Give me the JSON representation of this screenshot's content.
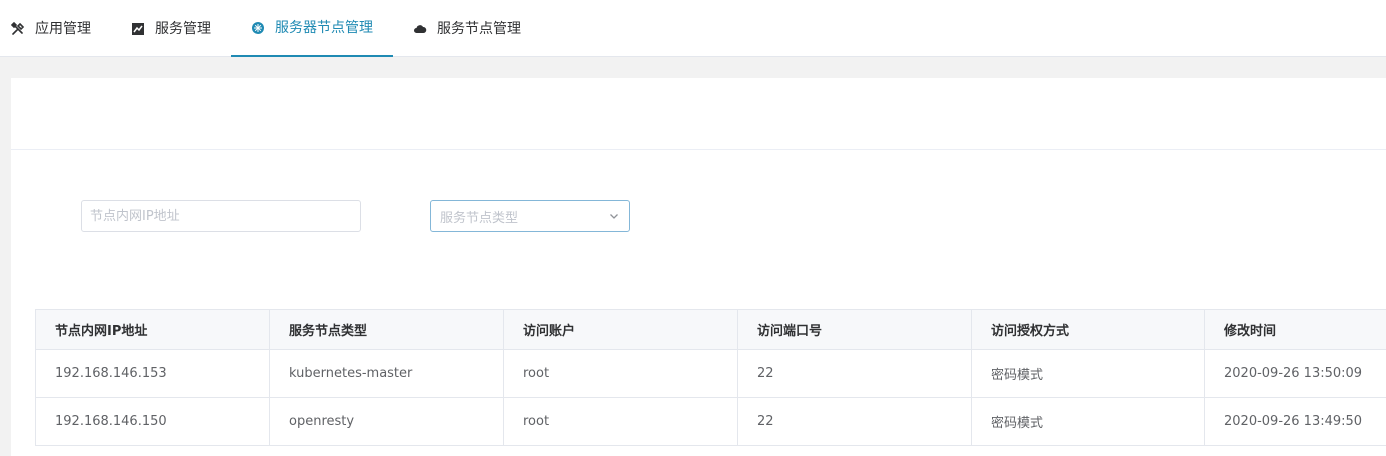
{
  "tabs": [
    {
      "label": "应用管理",
      "icon": "tools-icon"
    },
    {
      "label": "服务管理",
      "icon": "chart-icon"
    },
    {
      "label": "服务器节点管理",
      "icon": "server-node-icon",
      "active": true
    },
    {
      "label": "服务节点管理",
      "icon": "cloud-icon"
    }
  ],
  "filters": {
    "ip_placeholder": "节点内网IP地址",
    "type_placeholder": "服务节点类型"
  },
  "table": {
    "columns": [
      "节点内网IP地址",
      "服务节点类型",
      "访问账户",
      "访问端口号",
      "访问授权方式",
      "修改时间"
    ],
    "rows": [
      [
        "192.168.146.153",
        "kubernetes-master",
        "root",
        "22",
        "密码模式",
        "2020-09-26 13:50:09"
      ],
      [
        "192.168.146.150",
        "openresty",
        "root",
        "22",
        "密码模式",
        "2020-09-26 13:49:50"
      ]
    ]
  },
  "colors": {
    "accent": "#1f8ab3",
    "select_border": "#84b7d8"
  }
}
